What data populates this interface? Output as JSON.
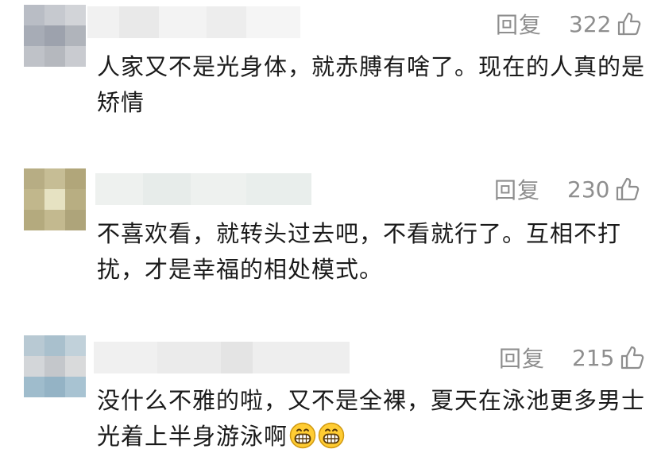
{
  "comments": [
    {
      "reply_label": "回复",
      "likes": "322",
      "text": "人家又不是光身体，就赤膊有啥了。现在的人真的是矫情"
    },
    {
      "reply_label": "回复",
      "likes": "230",
      "text": "不喜欢看，就转头过去吧，不看就行了。互相不打扰，才是幸福的相处模式。"
    },
    {
      "reply_label": "回复",
      "likes": "215",
      "text": "没什么不雅的啦，又不是全裸，夏天在泳池更多男士光着上半身游泳啊",
      "emojis": [
        "grinning-face-emoji",
        "grinning-face-emoji"
      ]
    }
  ]
}
